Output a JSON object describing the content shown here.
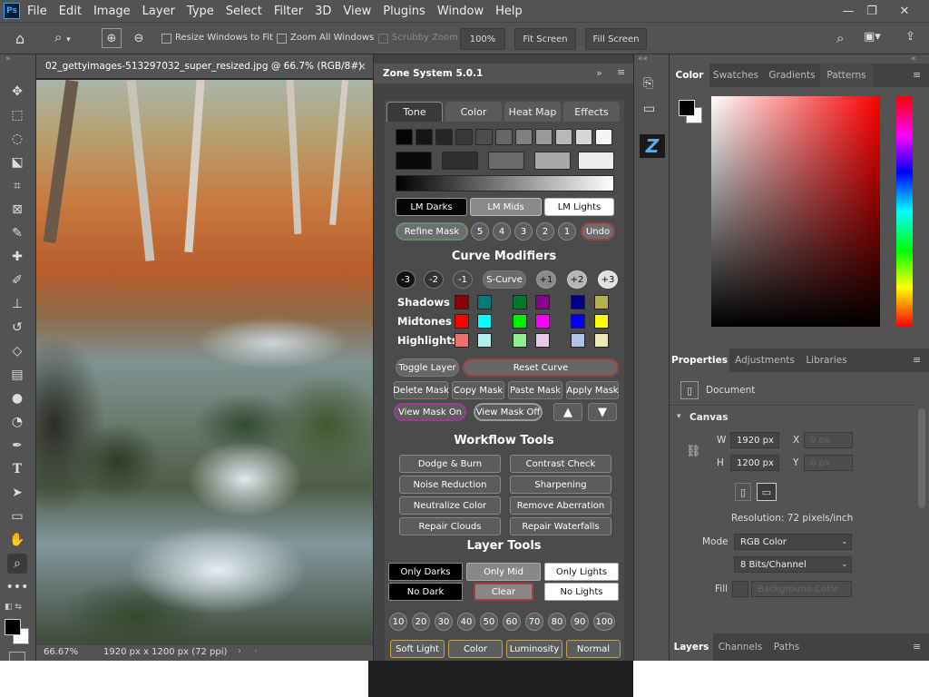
{
  "app": {
    "logo": "Ps"
  },
  "menu": [
    "File",
    "Edit",
    "Image",
    "Layer",
    "Type",
    "Select",
    "Filter",
    "3D",
    "View",
    "Plugins",
    "Window",
    "Help"
  ],
  "window_controls": {
    "minimize": "—",
    "restore": "❐",
    "close": "✕"
  },
  "options_bar": {
    "resize_windows": "Resize Windows to Fit",
    "zoom_all": "Zoom All Windows",
    "scrubby": "Scrubby Zoom",
    "zoom_value": "100%",
    "fit_screen": "Fit Screen",
    "fill_screen": "Fill Screen"
  },
  "document": {
    "tab_title": "02_gettyimages-513297032_super_resized.jpg @ 66.7% (RGB/8#)",
    "close": "×",
    "zoom": "66.67%",
    "info": "1920 px x 1200 px (72 ppi)"
  },
  "zone": {
    "title": "Zone System 5.0.1",
    "tabs": [
      "Tone",
      "Color",
      "Heat Map",
      "Effects"
    ],
    "lm": [
      "LM Darks",
      "LM Mids",
      "LM Lights"
    ],
    "refine": "Refine Mask",
    "zones": [
      "5",
      "4",
      "3",
      "2",
      "1"
    ],
    "undo": "Undo",
    "curve_title": "Curve Modifiers",
    "curve_btns": [
      "-3",
      "-2",
      "-1",
      "S-Curve",
      "+1",
      "+2",
      "+3"
    ],
    "rows": [
      "Shadows",
      "Midtones",
      "Highlights"
    ],
    "toggle_layer": "Toggle Layer",
    "reset_curve": "Reset Curve",
    "mask_btns": [
      "Delete Mask",
      "Copy Mask",
      "Paste Mask",
      "Apply Mask"
    ],
    "view_on": "View Mask On",
    "view_off": "View Mask Off",
    "workflow_title": "Workflow Tools",
    "workflow": [
      "Dodge & Burn",
      "Contrast Check",
      "Noise Reduction",
      "Sharpening",
      "Neutralize Color",
      "Remove Aberration",
      "Repair Clouds",
      "Repair Waterfalls"
    ],
    "layer_title": "Layer Tools",
    "layer_tools": [
      "Only Darks",
      "Only Mid",
      "Only Lights",
      "No Dark",
      "Clear",
      "No Lights"
    ],
    "opacity": [
      "10",
      "20",
      "30",
      "40",
      "50",
      "60",
      "70",
      "80",
      "90",
      "100"
    ],
    "blend": [
      "Soft Light",
      "Color",
      "Luminosity",
      "Normal"
    ]
  },
  "color_panel": {
    "tabs": [
      "Color",
      "Swatches",
      "Gradients",
      "Patterns"
    ]
  },
  "properties": {
    "tabs": [
      "Properties",
      "Adjustments",
      "Libraries"
    ],
    "document": "Document",
    "canvas": "Canvas",
    "w_label": "W",
    "w_value": "1920 px",
    "h_label": "H",
    "h_value": "1200 px",
    "x_label": "X",
    "x_value": "0 px",
    "y_label": "Y",
    "y_value": "0 px",
    "resolution": "Resolution: 72 pixels/inch",
    "mode_label": "Mode",
    "mode_value": "RGB Color",
    "bits_value": "8 Bits/Channel",
    "fill_label": "Fill",
    "fill_value": "Background Color"
  },
  "layers_panel": {
    "tabs": [
      "Layers",
      "Channels",
      "Paths"
    ]
  }
}
